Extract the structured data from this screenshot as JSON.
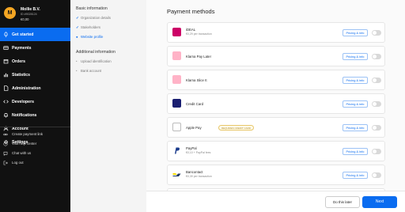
{
  "org": {
    "initial": "M",
    "name": "Mollie B.V.",
    "id": "ID #9028124",
    "balance": "€0,00"
  },
  "nav": {
    "items": [
      {
        "label": "Get started",
        "icon": "rocket-icon",
        "active": true
      },
      {
        "label": "Payments",
        "icon": "card-icon"
      },
      {
        "label": "Orders",
        "icon": "box-icon"
      },
      {
        "label": "Statistics",
        "icon": "chart-icon"
      },
      {
        "label": "Administration",
        "icon": "document-icon"
      },
      {
        "label": "Developers",
        "icon": "code-icon"
      },
      {
        "label": "Notifications",
        "icon": "bell-icon"
      },
      {
        "label": "Account",
        "icon": "user-icon"
      },
      {
        "label": "Settings",
        "icon": "gear-icon"
      }
    ],
    "secondary": [
      {
        "label": "Create payment link",
        "icon": "link-icon"
      },
      {
        "label": "Visit help center",
        "icon": "help-icon"
      },
      {
        "label": "Chat with us",
        "icon": "chat-icon"
      },
      {
        "label": "Log out",
        "icon": "logout-icon"
      }
    ]
  },
  "steps": {
    "basic_title": "Basic information",
    "basic": [
      {
        "label": "Organization details",
        "state": "done"
      },
      {
        "label": "Stakeholders",
        "state": "done"
      },
      {
        "label": "Website profile",
        "state": "current"
      }
    ],
    "additional_title": "Additional information",
    "additional": [
      {
        "label": "Upload identification",
        "state": "todo"
      },
      {
        "label": "Bank account",
        "state": "todo"
      }
    ]
  },
  "main": {
    "title": "Payment methods",
    "pricing_label": "Pricing & info",
    "methods": [
      {
        "name": "iDEAL",
        "sub": "€0,29 per transaction",
        "logo_color": "#cc0066",
        "logo": "ideal-logo-icon"
      },
      {
        "name": "Klarna Pay Later",
        "sub": "",
        "logo_color": "#ffb3c7",
        "logo": "klarna-logo-icon"
      },
      {
        "name": "Klarna Slice It",
        "sub": "",
        "logo_color": "#ffb3c7",
        "logo": "klarna-logo-icon"
      },
      {
        "name": "Credit Card",
        "sub": "",
        "logo_color": "#1a1f71",
        "logo": "credit-card-logo-icon"
      },
      {
        "name": "Apple Pay",
        "sub": "",
        "badge": "REQUIRES CREDIT CARD",
        "logo_color": "#ffffff",
        "logo": "apple-pay-logo-icon"
      },
      {
        "name": "PayPal",
        "sub": "€0,10 + PayPal fees",
        "logo_color": "#ffffff",
        "logo": "paypal-logo-icon"
      },
      {
        "name": "Bancontact",
        "sub": "€0,39 per transaction",
        "logo_color": "#ffffff",
        "logo": "bancontact-logo-icon"
      }
    ]
  },
  "footer": {
    "later_label": "Do this later",
    "next_label": "Next"
  },
  "colors": {
    "accent": "#0a6cf0",
    "sidebar_bg": "#111111"
  }
}
